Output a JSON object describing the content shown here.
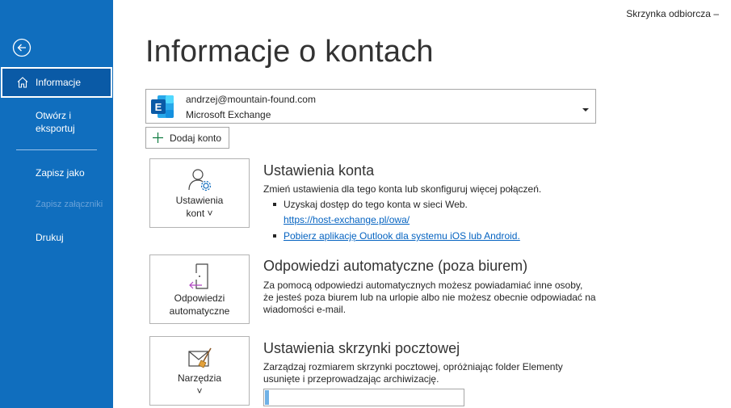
{
  "header": {
    "context_label": "Skrzynka odbiorcza –"
  },
  "sidebar": {
    "back_icon": "back-arrow-circle-icon",
    "items": [
      {
        "label": "Informacje",
        "icon": "home-icon",
        "active": true
      },
      {
        "label_line1": "Otwórz i",
        "label_line2": "eksportuj"
      },
      {
        "label": "Zapisz jako"
      },
      {
        "label": "Zapisz załączniki",
        "disabled": true
      },
      {
        "label": "Drukuj"
      }
    ]
  },
  "page": {
    "title": "Informacje o kontach"
  },
  "account": {
    "email": "andrzej@mountain-found.com",
    "type": "Microsoft Exchange",
    "logo_icon": "exchange-logo-icon",
    "add_label": "Dodaj konto"
  },
  "tiles": {
    "account_settings": {
      "line1": "Ustawienia",
      "line2": "kont ˅"
    },
    "auto_replies": {
      "line1": "Odpowiedzi",
      "line2": "automatyczne"
    },
    "tools": {
      "line1": "Narzędzia",
      "line2": "˅"
    }
  },
  "sections": {
    "account_settings": {
      "title": "Ustawienia konta",
      "desc": "Zmień ustawienia dla tego konta lub skonfiguruj więcej połączeń.",
      "bullet1": "Uzyskaj dostęp do tego konta w sieci Web.",
      "link1": "https://host-exchange.pl/owa/",
      "link2": "Pobierz aplikację Outlook dla systemu iOS lub Android."
    },
    "auto_replies": {
      "title": "Odpowiedzi automatyczne (poza biurem)",
      "line1": "Za pomocą odpowiedzi automatycznych możesz powiadamiać inne osoby,",
      "line2": "że jesteś poza biurem lub na urlopie albo nie możesz obecnie odpowiadać na",
      "line3": "wiadomości e-mail."
    },
    "mailbox": {
      "title": "Ustawienia skrzynki pocztowej",
      "line1": "Zarządzaj rozmiarem skrzynki pocztowej, opróżniając folder Elementy",
      "line2": "usunięte i przeprowadzając archiwizację.",
      "usage_fraction": 0.02
    }
  },
  "colors": {
    "sidebar": "#106ebe",
    "link": "#0563c1",
    "progress": "#6fb1e6"
  }
}
